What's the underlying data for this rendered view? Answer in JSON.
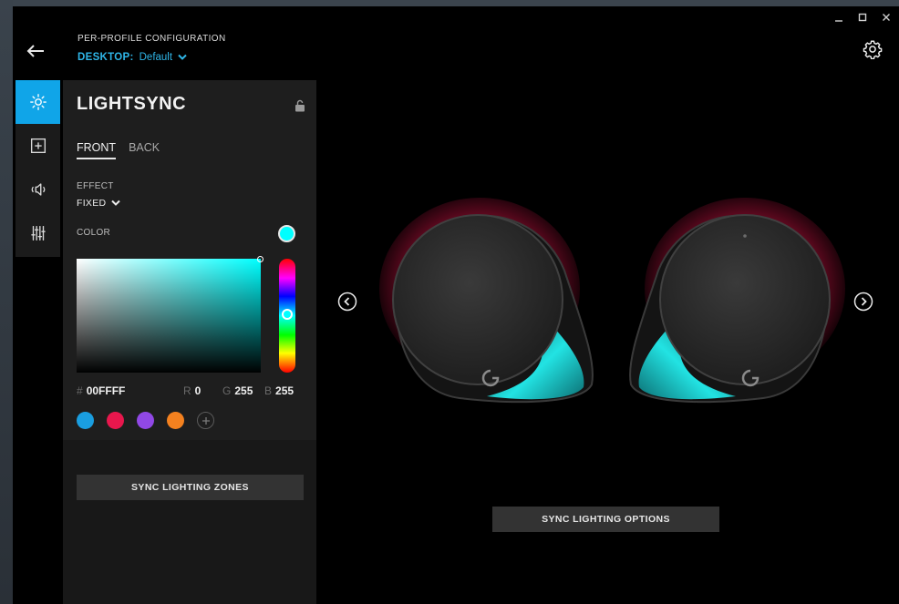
{
  "window": {
    "controls": [
      "minimize",
      "maximize",
      "close"
    ]
  },
  "header": {
    "profile_label": "PER-PROFILE CONFIGURATION",
    "profile_key": "DESKTOP:",
    "profile_value": "Default"
  },
  "sidenav": {
    "items": [
      {
        "name": "lightsync",
        "icon": "sun-icon",
        "active": true
      },
      {
        "name": "assignments",
        "icon": "plus-square-icon",
        "active": false
      },
      {
        "name": "audio",
        "icon": "speaker-icon",
        "active": false
      },
      {
        "name": "equalizer",
        "icon": "sliders-icon",
        "active": false
      }
    ]
  },
  "panel": {
    "title": "LIGHTSYNC",
    "tabs": [
      {
        "label": "FRONT",
        "active": true
      },
      {
        "label": "BACK",
        "active": false
      }
    ],
    "effect_label": "EFFECT",
    "effect_value": "FIXED",
    "color_label": "COLOR",
    "hex_hash": "#",
    "hex_value": "00FFFF",
    "r_label": "R",
    "r_value": "0",
    "g_label": "G",
    "g_value": "255",
    "b_label": "B",
    "b_value": "255",
    "swatches": [
      "#1a9ee0",
      "#e8174d",
      "#9148e6",
      "#f4811f"
    ],
    "sync_zones_label": "SYNC LIGHTING ZONES"
  },
  "viewport": {
    "sync_options_label": "SYNC LIGHTING OPTIONS"
  },
  "colors": {
    "accent": "#10a5e8",
    "current_color": "#00ffff",
    "profile_blue": "#2fb6e8"
  }
}
